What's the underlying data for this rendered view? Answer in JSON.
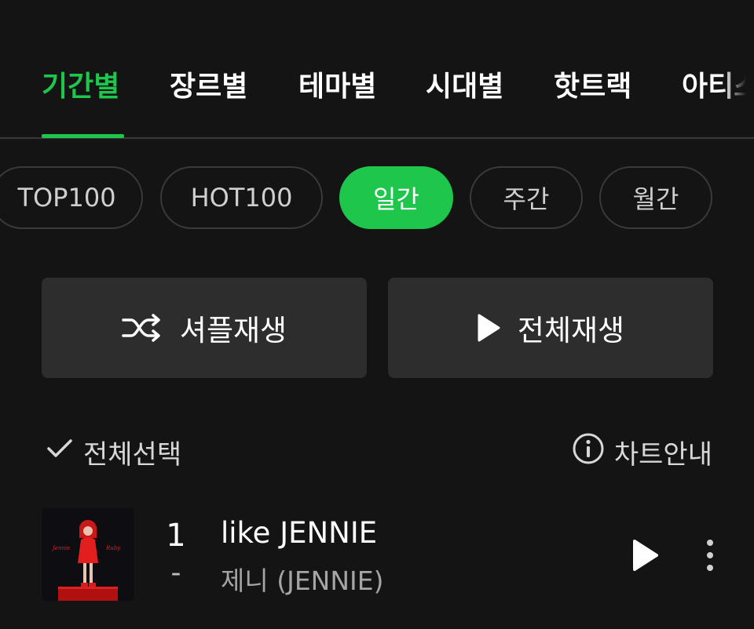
{
  "tabs": [
    {
      "label": "기간별",
      "active": true
    },
    {
      "label": "장르별",
      "active": false
    },
    {
      "label": "테마별",
      "active": false
    },
    {
      "label": "시대별",
      "active": false
    },
    {
      "label": "핫트랙",
      "active": false
    },
    {
      "label": "아티스",
      "active": false
    }
  ],
  "filters": [
    {
      "label": "TOP100",
      "active": false
    },
    {
      "label": "HOT100",
      "active": false
    },
    {
      "label": "일간",
      "active": true
    },
    {
      "label": "주간",
      "active": false
    },
    {
      "label": "월간",
      "active": false
    }
  ],
  "actions": {
    "shuffle_label": "셔플재생",
    "play_all_label": "전체재생"
  },
  "options": {
    "select_all_label": "전체선택",
    "chart_info_label": "차트안내"
  },
  "songs": [
    {
      "rank": "1",
      "change": "-",
      "title": "like JENNIE",
      "artist": "제니 (JENNIE)",
      "cover_text": [
        "Jennie",
        "Ruby"
      ]
    }
  ],
  "colors": {
    "accent": "#1ec64b",
    "background": "#141414",
    "button_bg": "#2d2d2d",
    "chip_border": "#3a3a3a"
  },
  "icons": [
    "shuffle-icon",
    "play-icon",
    "check-icon",
    "info-icon",
    "more-vertical-icon"
  ]
}
